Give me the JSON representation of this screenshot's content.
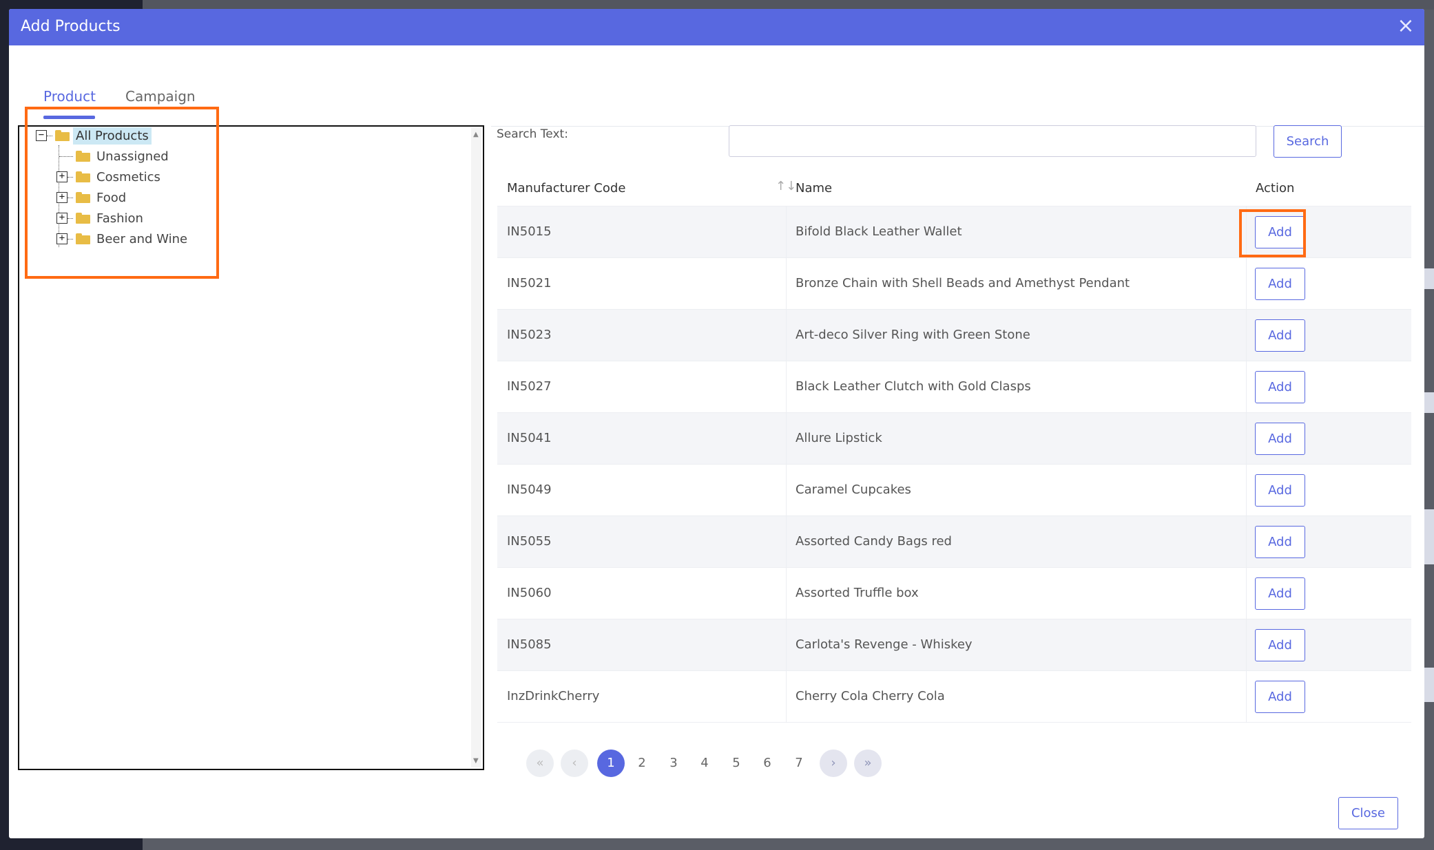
{
  "modal": {
    "title": "Add Products",
    "close_icon": "close-icon",
    "close_glyph": "×",
    "close_button": "Close"
  },
  "tabs": [
    {
      "label": "Product",
      "active": true
    },
    {
      "label": "Campaign",
      "active": false
    }
  ],
  "tree": {
    "root": {
      "label": "All Products",
      "toggle": "−",
      "selected": true
    },
    "children": [
      {
        "label": "Unassigned",
        "expandable": false
      },
      {
        "label": "Cosmetics",
        "expandable": true,
        "toggle": "+"
      },
      {
        "label": "Food",
        "expandable": true,
        "toggle": "+"
      },
      {
        "label": "Fashion",
        "expandable": true,
        "toggle": "+"
      },
      {
        "label": "Beer and Wine",
        "expandable": true,
        "toggle": "+"
      }
    ]
  },
  "search": {
    "label": "Search Text:",
    "value": "",
    "placeholder": "",
    "button": "Search"
  },
  "table": {
    "columns": {
      "code": "Manufacturer Code",
      "name": "Name",
      "action": "Action"
    },
    "sort_glyph": "↑↓",
    "rows": [
      {
        "code": "IN5015",
        "name": "Bifold Black Leather Wallet",
        "action": "Add"
      },
      {
        "code": "IN5021",
        "name": "Bronze Chain with Shell Beads and Amethyst Pendant",
        "action": "Add"
      },
      {
        "code": "IN5023",
        "name": "Art-deco Silver Ring with Green Stone",
        "action": "Add"
      },
      {
        "code": "IN5027",
        "name": "Black Leather Clutch with Gold Clasps",
        "action": "Add"
      },
      {
        "code": "IN5041",
        "name": "Allure Lipstick",
        "action": "Add"
      },
      {
        "code": "IN5049",
        "name": "Caramel Cupcakes",
        "action": "Add"
      },
      {
        "code": "IN5055",
        "name": "Assorted Candy Bags red",
        "action": "Add"
      },
      {
        "code": "IN5060",
        "name": "Assorted Truffle box",
        "action": "Add"
      },
      {
        "code": "IN5085",
        "name": "Carlota's Revenge - Whiskey",
        "action": "Add"
      },
      {
        "code": "InzDrinkCherry",
        "name": "Cherry Cola Cherry Cola",
        "action": "Add"
      }
    ]
  },
  "pagination": {
    "first": "«",
    "prev": "‹",
    "pages": [
      "1",
      "2",
      "3",
      "4",
      "5",
      "6",
      "7"
    ],
    "current": "1",
    "next": "›",
    "last": "»"
  },
  "colors": {
    "accent": "#5868e0",
    "highlight": "#ff6a13",
    "folder": "#e8bc45",
    "selected_bg": "#cce8f4"
  }
}
